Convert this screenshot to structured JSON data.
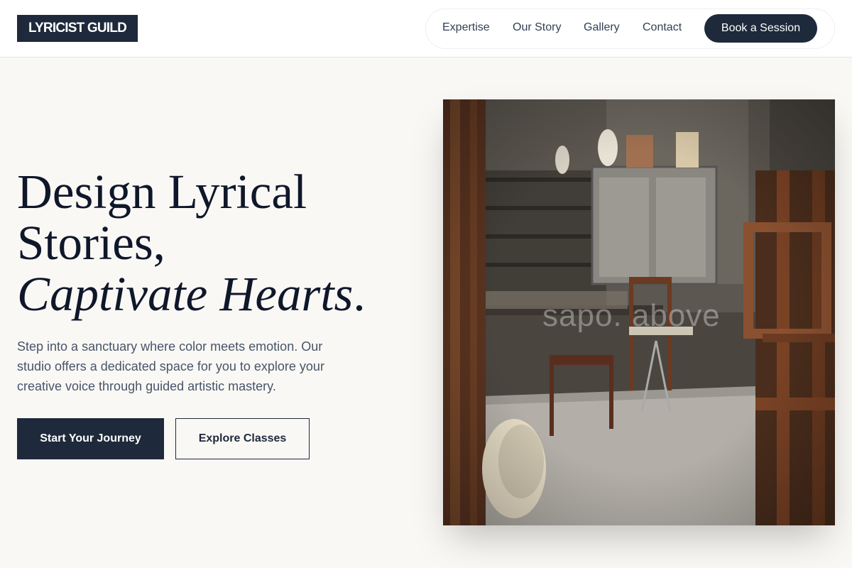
{
  "brand": {
    "logo": "LYRICIST GUILD"
  },
  "nav": {
    "items": [
      {
        "label": "Expertise"
      },
      {
        "label": "Our Story"
      },
      {
        "label": "Gallery"
      },
      {
        "label": "Contact"
      }
    ],
    "cta_label": "Book a Session"
  },
  "hero": {
    "title_line1": "Design Lyrical",
    "title_line2": "Stories,",
    "title_line3": "Captivate Hearts",
    "title_punct": ".",
    "description": "Step into a sanctuary where color meets emotion. Our studio offers a dedicated space for you to explore your creative voice through guided artistic mastery.",
    "primary_button": "Start Your Journey",
    "secondary_button": "Explore Classes"
  },
  "image": {
    "watermark": "sapo. above"
  },
  "colors": {
    "primary": "#1e293b",
    "background": "#faf8f5",
    "text_muted": "#475569"
  }
}
